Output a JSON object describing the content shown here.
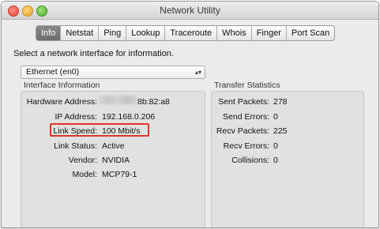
{
  "window": {
    "title": "Network Utility"
  },
  "tabs": [
    {
      "label": "Info",
      "active": true
    },
    {
      "label": "Netstat",
      "active": false
    },
    {
      "label": "Ping",
      "active": false
    },
    {
      "label": "Lookup",
      "active": false
    },
    {
      "label": "Traceroute",
      "active": false
    },
    {
      "label": "Whois",
      "active": false
    },
    {
      "label": "Finger",
      "active": false
    },
    {
      "label": "Port Scan",
      "active": false
    }
  ],
  "prompt": "Select a network interface for information.",
  "interface_select": {
    "value": "Ethernet (en0)"
  },
  "interface_info": {
    "heading": "Interface Information",
    "rows": [
      {
        "label": "Hardware Address:",
        "value": "8b:82:a8"
      },
      {
        "label": "IP Address:",
        "value": "192.168.0.206"
      },
      {
        "label": "Link Speed:",
        "value": "100 Mbit/s"
      },
      {
        "label": "Link Status:",
        "value": "Active"
      },
      {
        "label": "Vendor:",
        "value": "NVIDIA"
      },
      {
        "label": "Model:",
        "value": "MCP79-1"
      }
    ]
  },
  "transfer_stats": {
    "heading": "Transfer Statistics",
    "rows": [
      {
        "label": "Sent Packets:",
        "value": "278"
      },
      {
        "label": "Send Errors:",
        "value": "0"
      },
      {
        "label": "Recv Packets:",
        "value": "225"
      },
      {
        "label": "Recv Errors:",
        "value": "0"
      },
      {
        "label": "Collisions:",
        "value": "0"
      }
    ]
  },
  "colors": {
    "highlight": "#e0342a",
    "active_tab": "#7a7a7a"
  }
}
